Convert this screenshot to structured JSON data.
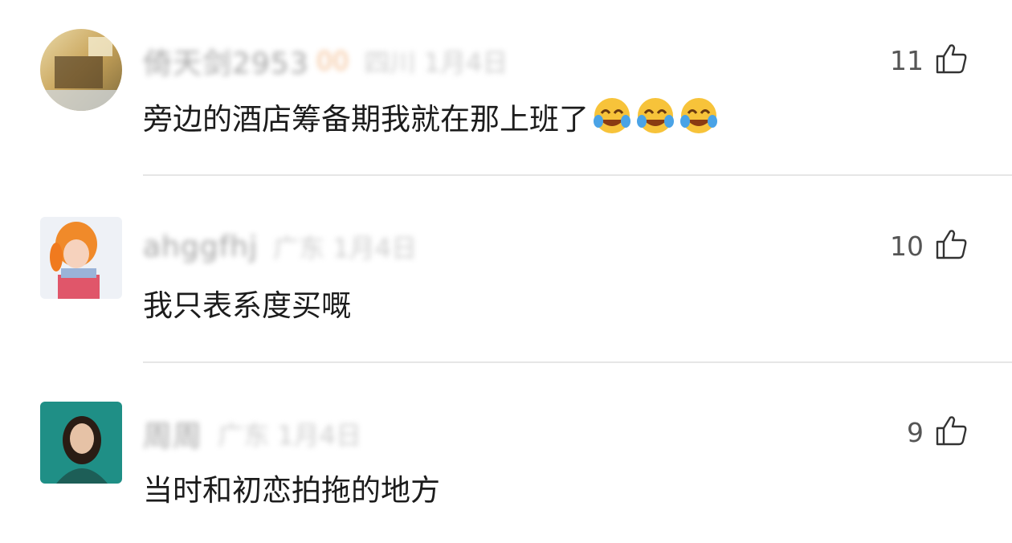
{
  "comments": [
    {
      "username": "倚天剑2953",
      "badge": "00",
      "location": "四川 1月4日",
      "text": "旁边的酒店筹备期我就在那上班了",
      "emoji_count": 3,
      "emoji": "crying-laughing-face-icon",
      "likes": "11"
    },
    {
      "username": "ahggfhj",
      "location": "广东 1月4日",
      "text": "我只表系度买嘅",
      "likes": "10"
    },
    {
      "username": "周周",
      "location": "广东 1月4日",
      "text": "当时和初恋拍拖的地方",
      "likes": "9"
    }
  ],
  "colors": {
    "text": "#1c1c1c",
    "meta": "#9a9a9a",
    "likes": "#555555",
    "divider": "#e6e6e6",
    "badge": "#f2b98a"
  }
}
